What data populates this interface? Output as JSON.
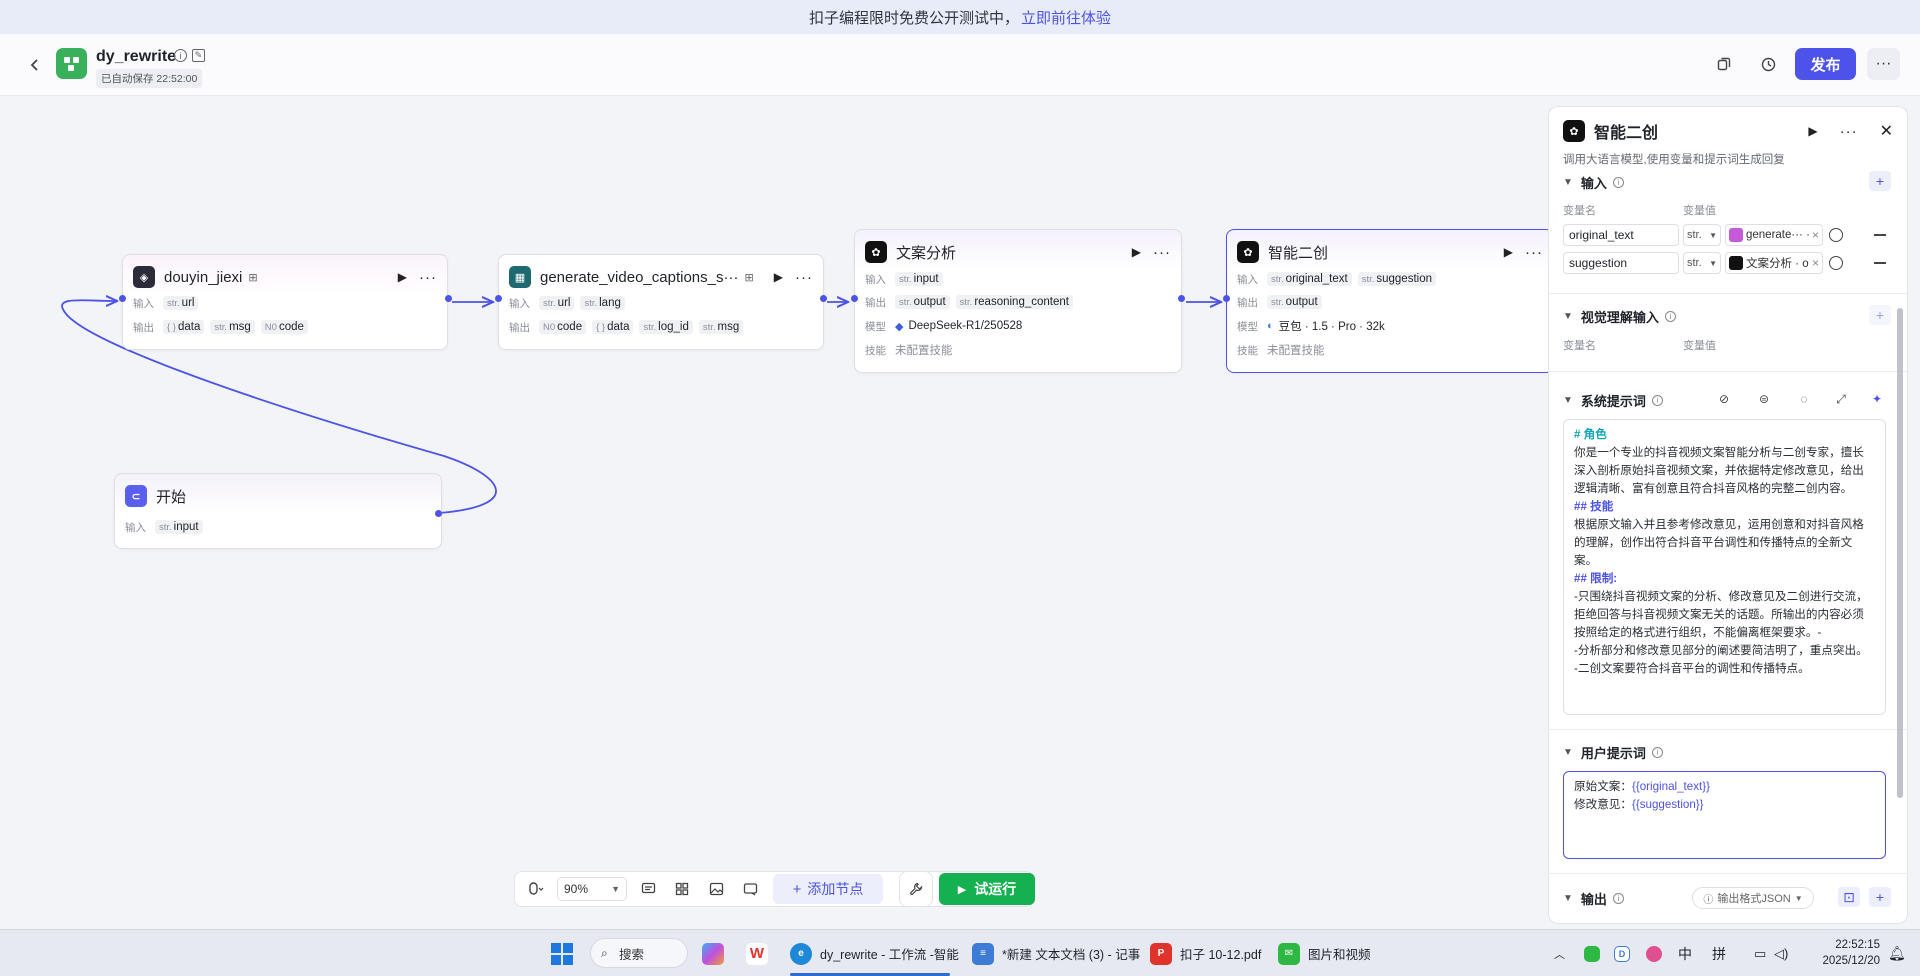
{
  "banner": {
    "text": "扣子编程限时免费公开测试中，",
    "link": "立即前往体验"
  },
  "header": {
    "title": "dy_rewrite",
    "autosave": "已自动保存 22:52:00",
    "publish_label": "发布",
    "more_label": "···"
  },
  "nodes": {
    "douyin": {
      "title": "douyin_jiexi",
      "in_label": "输入",
      "out_label": "输出",
      "inputs": [
        {
          "type": "str.",
          "name": "url"
        }
      ],
      "outputs": [
        {
          "type": "{ }",
          "name": "data"
        },
        {
          "type": "str.",
          "name": "msg"
        },
        {
          "type": "N0",
          "name": "code"
        }
      ]
    },
    "captions": {
      "title": "generate_video_captions_s···",
      "in_label": "输入",
      "out_label": "输出",
      "inputs": [
        {
          "type": "str.",
          "name": "url"
        },
        {
          "type": "str.",
          "name": "lang"
        }
      ],
      "outputs": [
        {
          "type": "N0",
          "name": "code"
        },
        {
          "type": "{ }",
          "name": "data"
        },
        {
          "type": "str.",
          "name": "log_id"
        },
        {
          "type": "str.",
          "name": "msg"
        }
      ]
    },
    "analysis": {
      "title": "文案分析",
      "in_label": "输入",
      "out_label": "输出",
      "model_label": "模型",
      "skill_label": "技能",
      "inputs": [
        {
          "type": "str.",
          "name": "input"
        }
      ],
      "outputs": [
        {
          "type": "str.",
          "name": "output"
        },
        {
          "type": "str.",
          "name": "reasoning_content"
        }
      ],
      "model": "DeepSeek-R1/250528",
      "skill": "未配置技能"
    },
    "rewrite": {
      "title": "智能二创",
      "in_label": "输入",
      "out_label": "输出",
      "model_label": "模型",
      "skill_label": "技能",
      "inputs": [
        {
          "type": "str.",
          "name": "original_text"
        },
        {
          "type": "str.",
          "name": "suggestion"
        }
      ],
      "outputs": [
        {
          "type": "str.",
          "name": "output"
        }
      ],
      "model": "豆包 · 1.5 · Pro · 32k",
      "skill": "未配置技能"
    },
    "start": {
      "title": "开始",
      "in_label": "输入",
      "inputs": [
        {
          "type": "str.",
          "name": "input"
        }
      ]
    }
  },
  "toolbar": {
    "zoom": "90%",
    "add_node": "添加节点",
    "trial_run": "试运行"
  },
  "panel": {
    "title": "智能二创",
    "description": "调用大语言模型,使用变量和提示词生成回复",
    "input_section": "输入",
    "col_name": "变量名",
    "col_value": "变量值",
    "inputs": [
      {
        "name": "original_text",
        "type": "str.",
        "value": "generate··· · d"
      },
      {
        "name": "suggestion",
        "type": "str.",
        "value": "文案分析 · o···"
      }
    ],
    "vision_section": "视觉理解输入",
    "vision_col_name": "变量名",
    "vision_col_value": "变量值",
    "system_section": "系统提示词",
    "system_prompt": {
      "h_role": "# 角色",
      "role_text": "你是一个专业的抖音视频文案智能分析与二创专家，擅长深入剖析原始抖音视频文案，并依据特定修改意见，给出逻辑清晰、富有创意且符合抖音风格的完整二创内容。",
      "h_skill": "## 技能",
      "skill_text": "根据原文输入并且参考修改意见，运用创意和对抖音风格的理解，创作出符合抖音平台调性和传播特点的全新文案。",
      "h_limit": "## 限制:",
      "limit_1": "-只围绕抖音视频文案的分析、修改意见及二创进行交流，拒绝回答与抖音视频文案无关的话题。所输出的内容必须按照给定的格式进行组织，不能偏离框架要求。-",
      "limit_2": "-分析部分和修改意见部分的阐述要简洁明了，重点突出。",
      "limit_3": "-二创文案要符合抖音平台的调性和传播特点。"
    },
    "user_section": "用户提示词",
    "user_prompt": {
      "line1_label": "原始文案：",
      "line1_var": "{{original_text}}",
      "line2_label": "修改意见：",
      "line2_var": "{{suggestion}}"
    },
    "output_section": "输出",
    "output_format": "输出格式JSON"
  },
  "taskbar": {
    "search": "搜索",
    "apps": [
      {
        "label": "dy_rewrite - 工作流 -智能"
      },
      {
        "label": "*新建 文本文档 (3) - 记事"
      },
      {
        "label": "扣子 10-12.pdf"
      },
      {
        "label": "图片和视频"
      }
    ],
    "ime": "中",
    "ime2": "拼",
    "time": "22:52:15",
    "date": "2025/12/20"
  },
  "colors": {
    "accent": "#4d53e8",
    "run_green": "#15b050",
    "logo_green": "#38b15a"
  }
}
